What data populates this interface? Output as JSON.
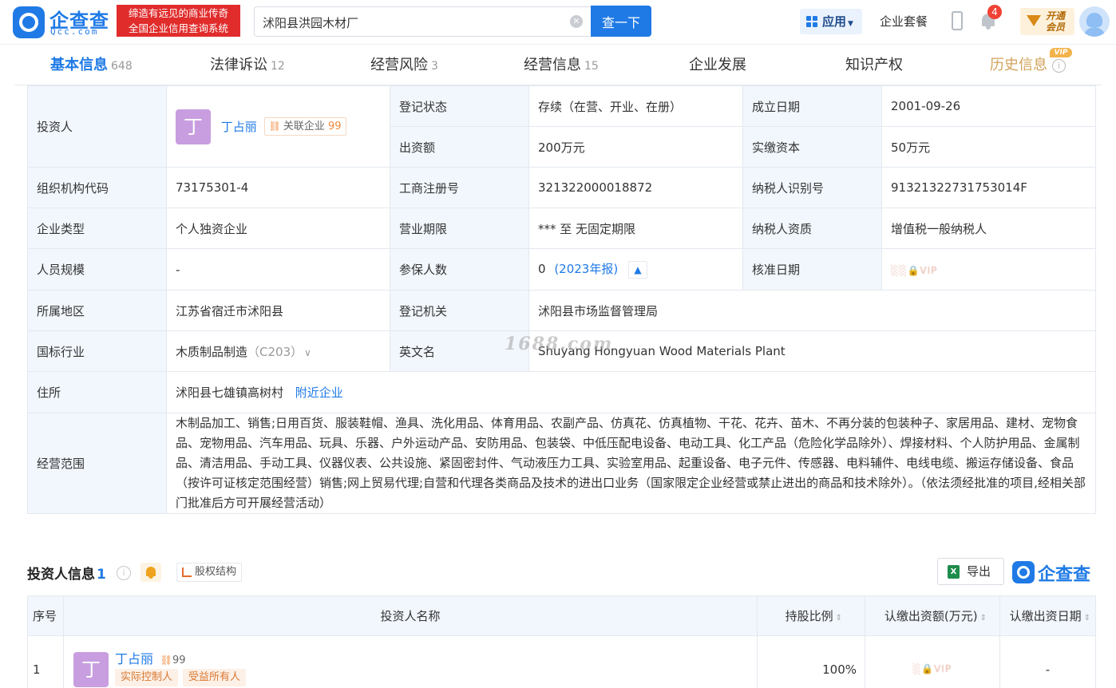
{
  "header": {
    "logo_text": "企查查",
    "logo_sub": "Qcc.com",
    "slogan_line1": "缔造有远见的商业传奇",
    "slogan_line2": "全国企业信用查询系统",
    "search_value": "沭阳县洪园木材厂",
    "search_button": "查一下",
    "app_button": "应用",
    "nav_suite": "企业套餐",
    "notification_count": "4",
    "vip_line1": "开通",
    "vip_line2": "会员",
    "brand_color": "#1f7ae6"
  },
  "tabs": [
    {
      "label": "基本信息",
      "count": "648"
    },
    {
      "label": "法律诉讼",
      "count": "12"
    },
    {
      "label": "经营风险",
      "count": "3"
    },
    {
      "label": "经营信息",
      "count": "15"
    },
    {
      "label": "企业发展",
      "count": ""
    },
    {
      "label": "知识产权",
      "count": ""
    },
    {
      "label": "历史信息",
      "count": "",
      "tag": "VIP"
    }
  ],
  "basic": {
    "investor_label": "投资人",
    "investor_avatar": "丁",
    "investor_name": "丁占丽",
    "related_label": "关联企业",
    "related_count": "99",
    "reg_status_label": "登记状态",
    "reg_status": "存续（在营、开业、在册）",
    "found_date_label": "成立日期",
    "found_date": "2001-09-26",
    "capital_label": "出资额",
    "capital": "200万元",
    "paid_capital_label": "实缴资本",
    "paid_capital": "50万元",
    "org_code_label": "组织机构代码",
    "org_code": "73175301-4",
    "biz_reg_no_label": "工商注册号",
    "biz_reg_no": "321322000018872",
    "tax_id_label": "纳税人识别号",
    "tax_id": "91321322731753014F",
    "company_type_label": "企业类型",
    "company_type": "个人独资企业",
    "biz_term_label": "营业期限",
    "biz_term": "*** 至 无固定期限",
    "tax_qual_label": "纳税人资质",
    "tax_qual": "增值税一般纳税人",
    "staff_size_label": "人员规模",
    "staff_size": "-",
    "insured_label": "参保人数",
    "insured_count": "0",
    "insured_year": "(2023年报)",
    "approve_date_label": "核准日期",
    "approve_date_lock": "VIP",
    "region_label": "所属地区",
    "region": "江苏省宿迁市沭阳县",
    "reg_authority_label": "登记机关",
    "reg_authority": "沭阳县市场监督管理局",
    "industry_label": "国标行业",
    "industry": "木质制品制造",
    "industry_code": "（C203）",
    "english_name_label": "英文名",
    "english_name": "Shuyang Hongyuan Wood Materials Plant",
    "address_label": "住所",
    "address": "沭阳县七雄镇高树村",
    "nearby_link": "附近企业",
    "scope_label": "经营范围",
    "scope": "木制品加工、销售;日用百货、服装鞋帽、渔具、洗化用品、体育用品、农副产品、仿真花、仿真植物、干花、花卉、苗木、不再分装的包装种子、家居用品、建材、宠物食品、宠物用品、汽车用品、玩具、乐器、户外运动产品、安防用品、包装袋、中低压配电设备、电动工具、化工产品（危险化学品除外）、焊接材料、个人防护用品、金属制品、清洁用品、手动工具、仪器仪表、公共设施、紧固密封件、气动液压力工具、实验室用品、起重设备、电子元件、传感器、电料辅件、电线电缆、搬运存储设备、食品（按许可证核定范围经营）销售;网上贸易代理;自营和代理各类商品及技术的进出口业务（国家限定企业经营或禁止进出的商品和技术除外）。（依法须经批准的项目,经相关部门批准后方可开展经营活动）"
  },
  "watermark": "1688.com",
  "investors": {
    "title": "投资人信息",
    "count": "1",
    "equity_button": "股权结构",
    "export_button": "导出",
    "brand": "企查查",
    "headers": [
      "序号",
      "投资人名称",
      "持股比例",
      "认缴出资额(万元)",
      "认缴出资日期"
    ],
    "rows": [
      {
        "index": "1",
        "avatar": "丁",
        "name": "丁占丽",
        "related": "99",
        "tags": [
          "实际控制人",
          "受益所有人"
        ],
        "ratio": "100%",
        "amount_lock": "VIP",
        "date": "-"
      }
    ]
  }
}
